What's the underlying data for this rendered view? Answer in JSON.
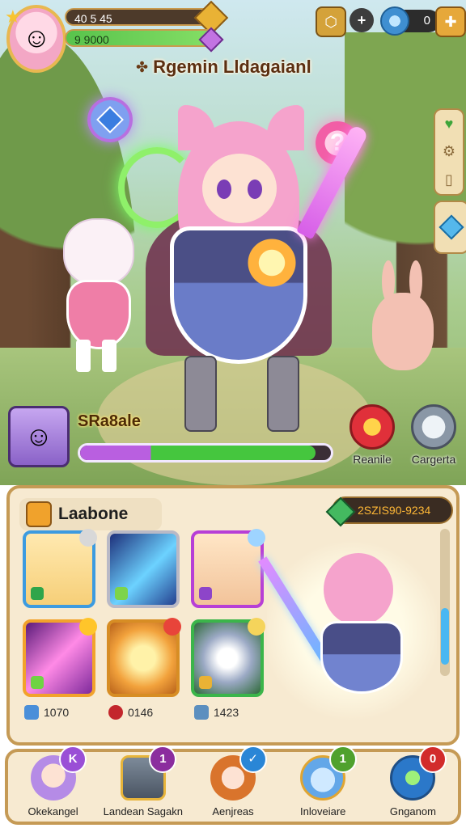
{
  "player": {
    "level_text": "40 5 45",
    "energy_text": "9 9000"
  },
  "top_right": {
    "gem_count": "0"
  },
  "event_title": "Rgemin Lldagaianl",
  "hero": {
    "name": "SRa8ale"
  },
  "actions": [
    {
      "label": "Reanile"
    },
    {
      "label": "Cargerta"
    }
  ],
  "inventory": {
    "tab_label": "Laabone",
    "currency_value": "2SZIS90-9234",
    "counts": [
      {
        "value": "1070"
      },
      {
        "value": "0146"
      },
      {
        "value": "1423"
      }
    ]
  },
  "nav": [
    {
      "label": "Okekangel",
      "badge": "K",
      "badge_color": "#9a4fd6"
    },
    {
      "label": "Landean Sagakn",
      "badge": "1",
      "badge_color": "#8b2d9e"
    },
    {
      "label": "Aenjreas",
      "badge": "",
      "badge_color": "#2a86d6"
    },
    {
      "label": "Inloveiare",
      "badge": "1",
      "badge_color": "#4fa12d"
    },
    {
      "label": "Gnganom",
      "badge": "0",
      "badge_color": "#d22b2b"
    }
  ],
  "icons": {
    "hex": "hexagon-badge-icon",
    "plus": "plus-icon",
    "gem": "blue-gem-icon",
    "puzzle": "puzzle-icon",
    "side_top": "heart-icon",
    "side_mid": "gear-icon",
    "side_bottom": "scroll-icon"
  },
  "colors": {
    "panel_bg": "#f7ead1",
    "panel_border": "#c59a55",
    "xp_fill": "#45c63e",
    "energy_fill": "#58c34c"
  }
}
